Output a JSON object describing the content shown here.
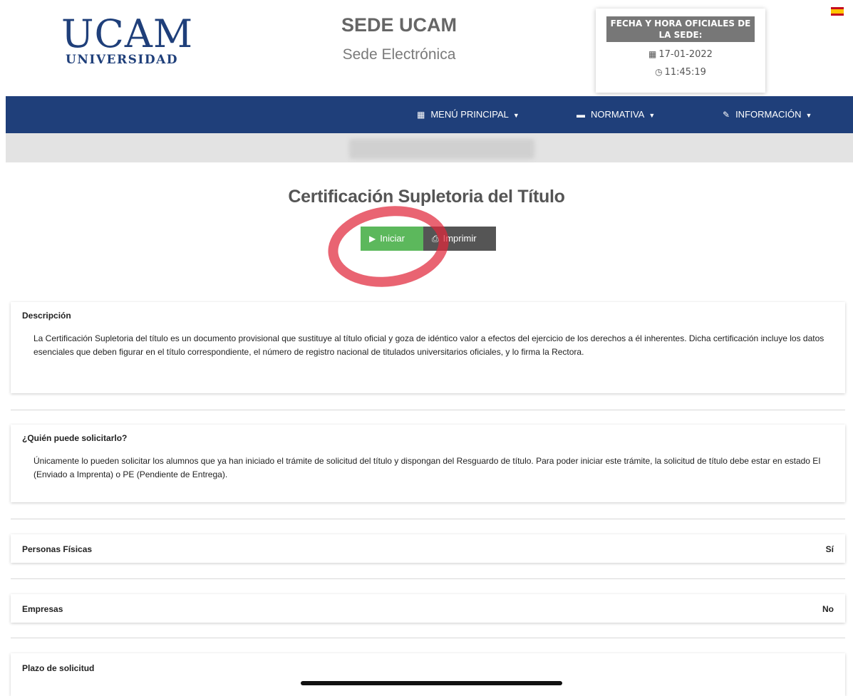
{
  "logo": {
    "main": "UCAM",
    "sub": "UNIVERSIDAD"
  },
  "site": {
    "title": "SEDE UCAM",
    "subtitle": "Sede Electrónica"
  },
  "datetime": {
    "title_line1": "FECHA Y HORA OFICIALES DE",
    "title_line2": "LA SEDE:",
    "date": "17-01-2022",
    "time": "11:45:19",
    "date_icon": "calendar-icon",
    "time_icon": "clock-icon"
  },
  "language": {
    "flag": "spain-flag"
  },
  "nav": {
    "items": [
      {
        "label": "MENÚ PRINCIPAL",
        "icon": "grid-icon"
      },
      {
        "label": "NORMATIVA",
        "icon": "briefcase-icon"
      },
      {
        "label": "INFORMACIÓN",
        "icon": "edit-icon"
      }
    ]
  },
  "page": {
    "title": "Certificación Supletoria del Título",
    "buttons": {
      "start": "Iniciar",
      "print": "Imprimir"
    }
  },
  "sections": {
    "descripcion": {
      "title": "Descripción",
      "text": "La Certificación Supletoria del título es un documento provisional que sustituye al título oficial y goza de idéntico valor a efectos del ejercicio de los derechos a él inherentes. Dicha certificación incluye los datos esenciales que deben figurar en el título correspondiente, el número de registro nacional de titulados universitarios oficiales, y lo firma la Rectora."
    },
    "quien": {
      "title": "¿Quién puede solicitarlo?",
      "text": "Únicamente lo pueden solicitar los alumnos que ya han iniciado el trámite de solicitud del título y dispongan del Resguardo de título. Para poder iniciar este trámite, la solicitud de título debe estar en estado EI (Enviado a Imprenta) o PE (Pendiente de Entrega)."
    },
    "personas": {
      "title": "Personas Físicas",
      "value": "Sí"
    },
    "empresas": {
      "title": "Empresas",
      "value": "No"
    },
    "plazo": {
      "title": "Plazo de solicitud"
    }
  },
  "colors": {
    "brand": "#1f3f7a",
    "start_button": "#5cb85c",
    "print_button": "#555555"
  }
}
